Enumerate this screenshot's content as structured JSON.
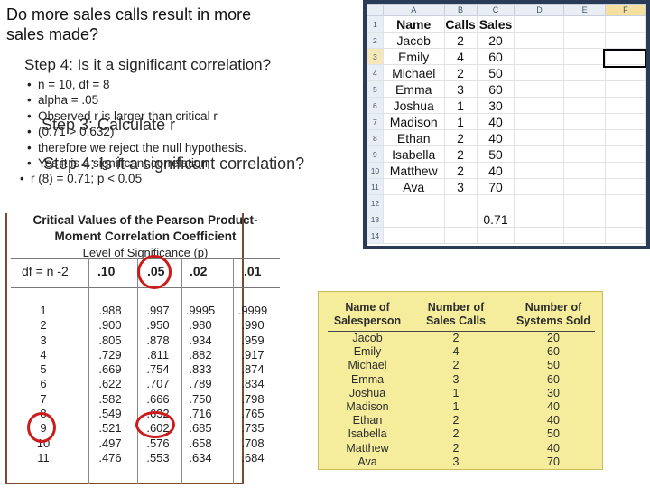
{
  "slide": {
    "question": "Do more sales calls result in more sales made?",
    "step_heading": "Step 4: Is it a significant correlation?",
    "bullets": [
      "n = 10, df = 8",
      "alpha = .05",
      "Observed r is larger than critical r",
      "(0.71 > 0.632)",
      "therefore we reject the null hypothesis.",
      "Yes it is a significant correlation"
    ],
    "last_bullet": "r (8) = 0.71; p < 0.05",
    "overlay_step3": "Step 3: Calculate r",
    "overlay_step4": "Step 4: Is it a significant correlation?"
  },
  "spreadsheet": {
    "col_headers": [
      "A",
      "B",
      "C",
      "D",
      "E",
      "F"
    ],
    "row_numbers": [
      "1",
      "2",
      "3",
      "4",
      "5",
      "6",
      "7",
      "8",
      "9",
      "10",
      "11",
      "12",
      "13",
      "14"
    ],
    "header_row": [
      "Name",
      "Calls",
      "Sales"
    ],
    "rows": [
      [
        "Jacob",
        "2",
        "20"
      ],
      [
        "Emily",
        "4",
        "60"
      ],
      [
        "Michael",
        "2",
        "50"
      ],
      [
        "Emma",
        "3",
        "60"
      ],
      [
        "Joshua",
        "1",
        "30"
      ],
      [
        "Madison",
        "1",
        "40"
      ],
      [
        "Ethan",
        "2",
        "40"
      ],
      [
        "Isabella",
        "2",
        "50"
      ],
      [
        "Matthew",
        "2",
        "40"
      ],
      [
        "Ava",
        "3",
        "70"
      ]
    ],
    "result": "0.71"
  },
  "critical_table": {
    "title": "Critical Values of the Pearson Product-Moment Correlation Coefficient",
    "subtitle": "Level of Significance (p)",
    "df_header": "df = n -2",
    "alpha_headers": [
      ".10",
      ".05",
      ".02",
      ".01"
    ],
    "df_values": [
      "1",
      "2",
      "3",
      "4",
      "5",
      "6",
      "7",
      "8",
      "9",
      "10",
      "11"
    ],
    "columns": [
      [
        ".988",
        ".900",
        ".805",
        ".729",
        ".669",
        ".622",
        ".582",
        ".549",
        ".521",
        ".497",
        ".476"
      ],
      [
        ".997",
        ".950",
        ".878",
        ".811",
        ".754",
        ".707",
        ".666",
        ".632",
        ".602",
        ".576",
        ".553"
      ],
      [
        ".9995",
        ".980",
        ".934",
        ".882",
        ".833",
        ".789",
        ".750",
        ".716",
        ".685",
        ".658",
        ".634"
      ],
      [
        ".9999",
        ".990",
        ".959",
        ".917",
        ".874",
        ".834",
        ".798",
        ".765",
        ".735",
        ".708",
        ".684"
      ]
    ]
  },
  "sales_table": {
    "headers": [
      "Name of Salesperson",
      "Number of Sales Calls",
      "Number of Systems Sold"
    ],
    "names": [
      "Jacob",
      "Emily",
      "Michael",
      "Emma",
      "Joshua",
      "Madison",
      "Ethan",
      "Isabella",
      "Matthew",
      "Ava"
    ],
    "calls": [
      "2",
      "4",
      "2",
      "3",
      "1",
      "1",
      "2",
      "2",
      "2",
      "3"
    ],
    "sold": [
      "20",
      "60",
      "50",
      "60",
      "30",
      "40",
      "40",
      "50",
      "40",
      "70"
    ]
  }
}
